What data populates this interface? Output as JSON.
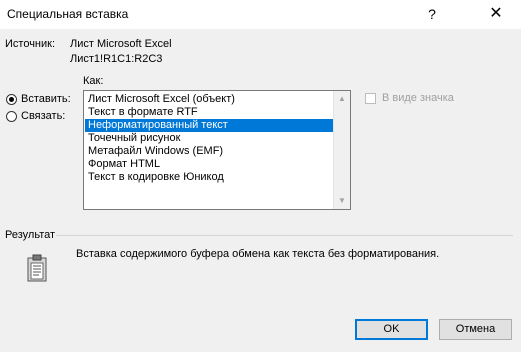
{
  "dialog": {
    "title": "Специальная вставка",
    "help_glyph": "?",
    "close_glyph": "✕"
  },
  "source": {
    "label": "Источник:",
    "name": "Лист Microsoft Excel",
    "range": "Лист1!R1C1:R2C3"
  },
  "as_label": "Как:",
  "options": {
    "paste": {
      "label": "Вставить:",
      "checked": true
    },
    "link": {
      "label": "Связать:",
      "checked": false
    }
  },
  "formats": {
    "items": [
      "Лист Microsoft Excel (объект)",
      "Текст в формате RTF",
      "Неформатированный текст",
      "Точечный рисунок",
      "Метафайл Windows (EMF)",
      "Формат HTML",
      "Текст в кодировке Юникод"
    ],
    "selected_index": 2
  },
  "display_as_icon": {
    "label": "В виде значка",
    "checked": false,
    "enabled": false
  },
  "result": {
    "header": "Результат",
    "text": "Вставка содержимого буфера обмена как текста без форматирования."
  },
  "buttons": {
    "ok": "OK",
    "cancel": "Отмена"
  },
  "icons": {
    "help": "help-icon",
    "close": "close-icon",
    "result": "clipboard-icon",
    "scroll_up": "scroll-up-arrow-icon",
    "scroll_down": "scroll-down-arrow-icon"
  },
  "colors": {
    "selection": "#0078d7",
    "dialog_bg": "#f0f0f0"
  }
}
